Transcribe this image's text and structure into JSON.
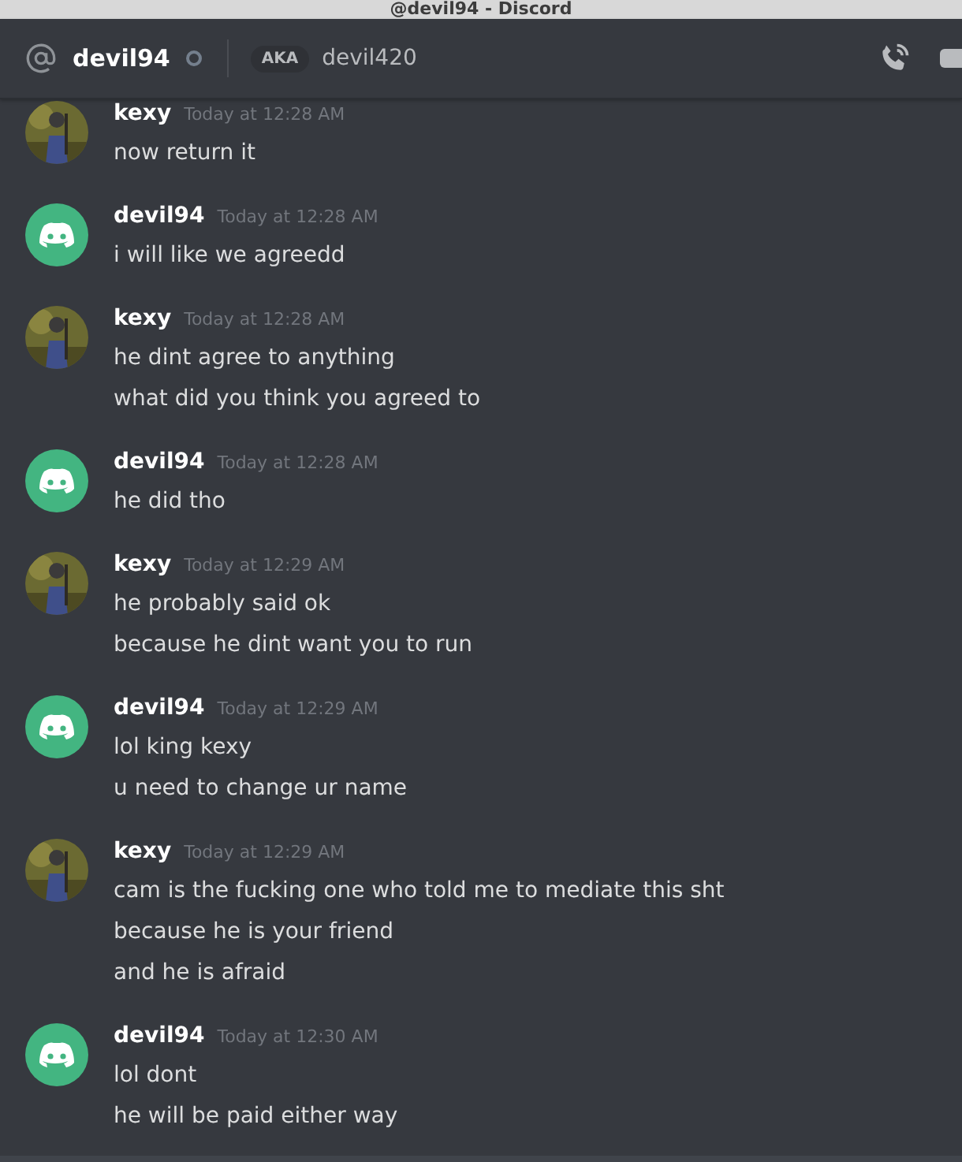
{
  "window": {
    "title": "@devil94 - Discord"
  },
  "header": {
    "name": "devil94",
    "online": false,
    "aka_label": "AKA",
    "aka": "devil420"
  },
  "messages": [
    {
      "author": "kexy",
      "kind": "picture",
      "time": "Today at 12:28 AM",
      "lines": [
        "now return it"
      ]
    },
    {
      "author": "devil94",
      "kind": "logo",
      "time": "Today at 12:28 AM",
      "lines": [
        "i will like we agreedd"
      ]
    },
    {
      "author": "kexy",
      "kind": "picture",
      "time": "Today at 12:28 AM",
      "lines": [
        "he dint agree to anything",
        "what did you think you agreed to"
      ]
    },
    {
      "author": "devil94",
      "kind": "logo",
      "time": "Today at 12:28 AM",
      "lines": [
        "he did tho"
      ]
    },
    {
      "author": "kexy",
      "kind": "picture",
      "time": "Today at 12:29 AM",
      "lines": [
        "he probably said ok",
        "because he dint want you to run"
      ]
    },
    {
      "author": "devil94",
      "kind": "logo",
      "time": "Today at 12:29 AM",
      "lines": [
        "lol king kexy",
        "u need to change ur name"
      ]
    },
    {
      "author": "kexy",
      "kind": "picture",
      "time": "Today at 12:29 AM",
      "lines": [
        "cam is the fucking one who told me to mediate this sht",
        "because he is your friend",
        "and he is afraid"
      ]
    },
    {
      "author": "devil94",
      "kind": "logo",
      "time": "Today at 12:30 AM",
      "lines": [
        "lol dont",
        "he will be paid either way"
      ]
    }
  ]
}
